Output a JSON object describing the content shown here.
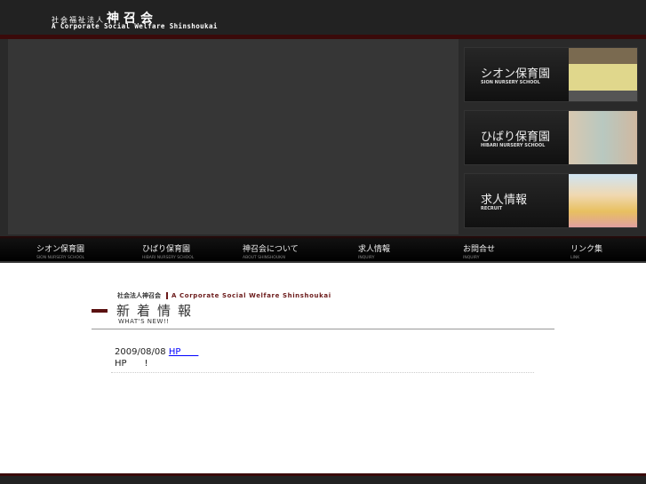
{
  "header": {
    "logo_small": "社会福祉法人",
    "logo_name": "神召会",
    "logo_en": "A Corporate Social Welfare Shinshoukai"
  },
  "banners": [
    {
      "title": "シオン保育園",
      "sub": "SION NURSERY SCHOOL",
      "color": "#d8cf8a"
    },
    {
      "title": "ひばり保育園",
      "sub": "HIBARI NURSERY SCHOOL",
      "color": "#c9bca8"
    },
    {
      "title": "求人情報",
      "sub": "RECRUIT",
      "color": "#b9d2e4"
    }
  ],
  "nav": [
    {
      "title": "シオン保育園",
      "sub": "SION NURSERY SCHOOL"
    },
    {
      "title": "ひばり保育園",
      "sub": "HIBARI NURSERY SCHOOL"
    },
    {
      "title": "神召会について",
      "sub": "ABOUT SHINSHOUKAI"
    },
    {
      "title": "求人情報",
      "sub": "INQUIRY"
    },
    {
      "title": "お問合せ",
      "sub": "INQUIRY"
    },
    {
      "title": "リンク集",
      "sub": "LINK"
    }
  ],
  "section": {
    "top_jp": "社会法人神召会",
    "top_en": "A Corporate Social Welfare Shinshoukai",
    "title": "新着情報",
    "subtitle": "WHAT'S NEW!!"
  },
  "news": [
    {
      "date": "2009/08/08",
      "link": "HP　　",
      "body": "HP　　!"
    }
  ]
}
